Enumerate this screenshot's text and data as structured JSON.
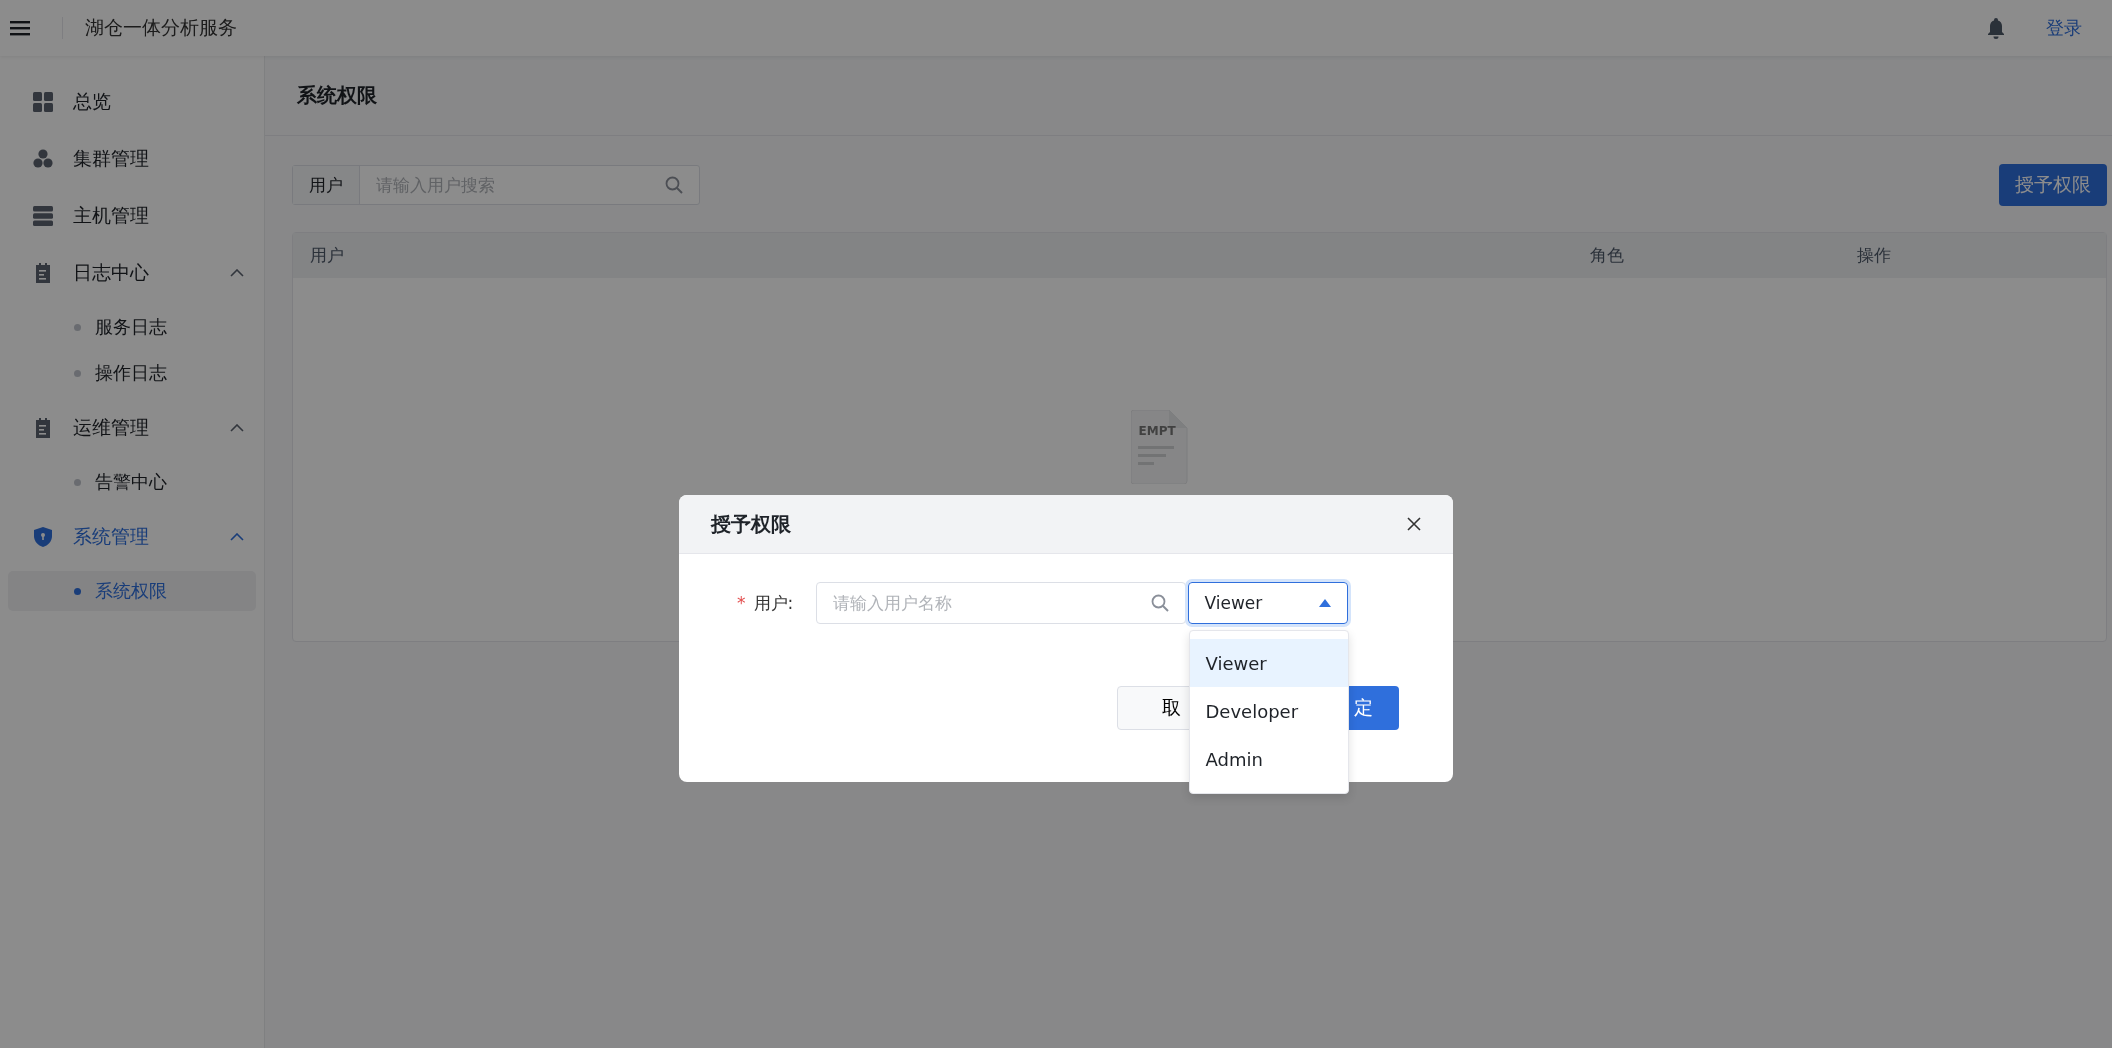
{
  "header": {
    "title": "湖仓一体分析服务",
    "login": "登录"
  },
  "sidebar": {
    "items": [
      {
        "label": "总览"
      },
      {
        "label": "集群管理"
      },
      {
        "label": "主机管理"
      },
      {
        "label": "日志中心",
        "expanded": true,
        "children": [
          {
            "label": "服务日志",
            "selected": false
          },
          {
            "label": "操作日志",
            "selected": false
          }
        ]
      },
      {
        "label": "运维管理",
        "expanded": true,
        "children": [
          {
            "label": "告警中心",
            "selected": false
          }
        ]
      },
      {
        "label": "系统管理",
        "expanded": true,
        "children": [
          {
            "label": "系统权限",
            "selected": true
          }
        ]
      }
    ]
  },
  "page": {
    "title": "系统权限",
    "search": {
      "label": "用户",
      "placeholder": "请输入用户搜索"
    },
    "grant_button": "授予权限",
    "table": {
      "columns": [
        "用户",
        "角色",
        "操作"
      ],
      "empty_label": "EMPT"
    }
  },
  "dialog": {
    "title": "授予权限",
    "field": {
      "label": "用户:",
      "required_mark": "*",
      "placeholder": "请输入用户名称"
    },
    "select": {
      "value": "Viewer",
      "open": true,
      "options": [
        {
          "label": "Viewer",
          "selected": true
        },
        {
          "label": "Developer",
          "selected": false
        },
        {
          "label": "Admin",
          "selected": false
        }
      ]
    },
    "buttons": {
      "cancel": "取",
      "confirm": "定"
    }
  }
}
